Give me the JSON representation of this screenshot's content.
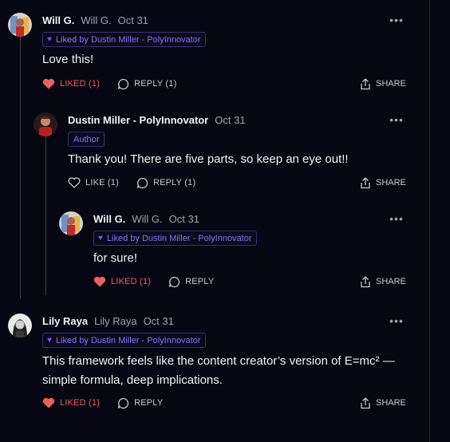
{
  "colors": {
    "background": "#070713",
    "liked": "#f05d5d",
    "badge": "#8d70ff"
  },
  "comments": [
    {
      "name": "Will G.",
      "handle": "Will G.",
      "date": "Oct 31",
      "badge": "Liked by Dustin Miller - PolyInnovator",
      "body": "Love this!",
      "like_label": "LIKED (1)",
      "reply_label": "REPLY (1)",
      "share_label": "SHARE",
      "liked": true
    },
    {
      "name": "Dustin Miller - PolyInnovator",
      "date": "Oct 31",
      "author_badge": "Author",
      "body": "Thank you! There are five parts, so keep an eye out!!",
      "like_label": "LIKE (1)",
      "reply_label": "REPLY (1)",
      "share_label": "SHARE",
      "liked": false
    },
    {
      "name": "Will G.",
      "handle": "Will G.",
      "date": "Oct 31",
      "badge": "Liked by Dustin Miller - PolyInnovator",
      "body": "for sure!",
      "like_label": "LIKED (1)",
      "reply_label": "REPLY",
      "share_label": "SHARE",
      "liked": true
    },
    {
      "name": "Lily Raya",
      "handle": "Lily Raya",
      "date": "Oct 31",
      "badge": "Liked by Dustin Miller - PolyInnovator",
      "body_line1": "This framework feels like the content creator’s version of E=mc² —",
      "body_line2": "simple formula, deep implications.",
      "like_label": "LIKED (1)",
      "reply_label": "REPLY",
      "share_label": "SHARE",
      "liked": true
    }
  ],
  "icons": {
    "more": "more-horizontal-icon",
    "heart": "heart-icon",
    "reply": "reply-bubble-icon",
    "share": "share-icon"
  }
}
